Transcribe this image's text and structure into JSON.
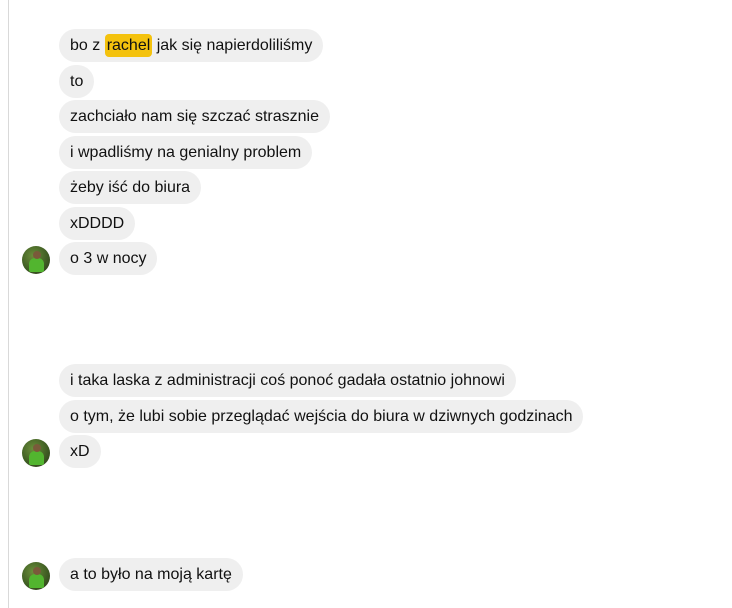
{
  "messages": {
    "group1": [
      {
        "before": "bo z ",
        "highlight": "rachel",
        "after": " jak się napierdoliliśmy"
      },
      {
        "text": "to"
      },
      {
        "text": "zachciało nam się szczać strasznie"
      },
      {
        "text": "i wpadliśmy na genialny problem"
      },
      {
        "text": "żeby iść do biura"
      },
      {
        "text": "xDDDD"
      },
      {
        "text": "o 3 w nocy"
      }
    ],
    "group2": [
      {
        "text": "i taka laska z administracji coś ponoć gadała ostatnio johnowi"
      },
      {
        "text": "o tym, że lubi sobie przeglądać wejścia do biura w dziwnych godzinach"
      },
      {
        "text": "xD"
      }
    ],
    "group3": [
      {
        "text": "a to było na moją kartę"
      }
    ]
  },
  "colors": {
    "bubble_bg": "#efefef",
    "highlight": "#f4c20d",
    "text": "#111111"
  },
  "icons": {
    "avatar": "user-avatar-icon"
  }
}
